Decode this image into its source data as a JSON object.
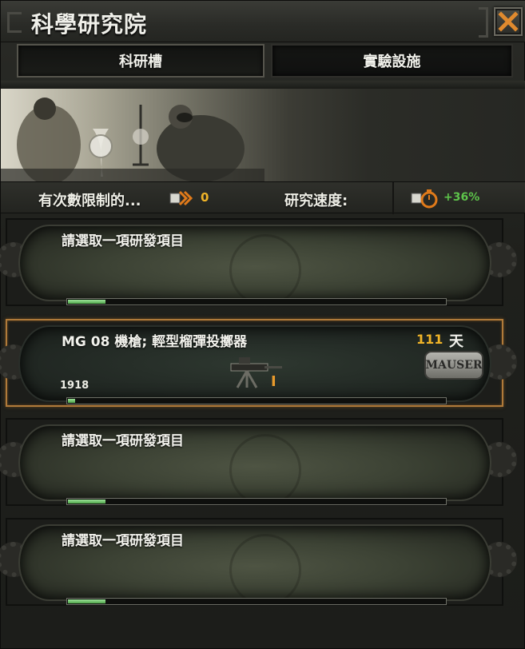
{
  "window": {
    "title": "科學研究院",
    "close_icon": "close-icon"
  },
  "tabs": [
    {
      "label": "科研槽",
      "active": true
    },
    {
      "label": "實驗設施",
      "active": false
    }
  ],
  "info_bar": {
    "limited_label": "有次數限制的...",
    "limited_value": "0",
    "speed_label": "研究速度:",
    "speed_value": "+36%",
    "colors": {
      "value_gold": "#f0b428",
      "value_green": "#5dc34a"
    }
  },
  "slots": [
    {
      "label": "請選取一項研發項目",
      "progress": 0.1
    },
    {
      "label": "MG 08 機槍; 輕型榴彈投擲器",
      "days_value": "111",
      "days_unit": "天",
      "year": "1918",
      "level": "I",
      "badge": "MAUSER",
      "progress": 0.02,
      "active": true
    },
    {
      "label": "請選取一項研發項目",
      "progress": 0.1
    },
    {
      "label": "請選取一項研發項目",
      "progress": 0.1
    }
  ]
}
